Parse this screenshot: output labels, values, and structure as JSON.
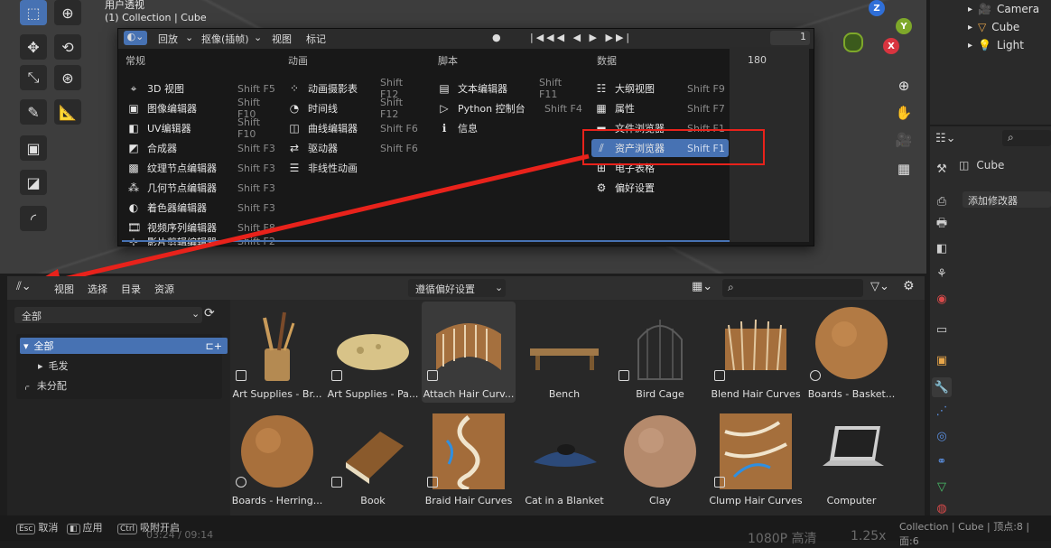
{
  "viewport": {
    "title": "用户透视",
    "subtitle": "(1) Collection | Cube"
  },
  "popup": {
    "header": {
      "menu1": "回放",
      "menu2": "抠像(插帧)",
      "menu3": "视图",
      "menu4": "标记",
      "frame": "1"
    },
    "timeline_frame": "180",
    "columns": [
      "常规",
      "动画",
      "脚本",
      "数据"
    ],
    "general": [
      {
        "label": "3D 视图",
        "shortcut": "Shift F5"
      },
      {
        "label": "图像编辑器",
        "shortcut": "Shift F10"
      },
      {
        "label": "UV编辑器",
        "shortcut": "Shift F10"
      },
      {
        "label": "合成器",
        "shortcut": "Shift F3"
      },
      {
        "label": "纹理节点编辑器",
        "shortcut": "Shift F3"
      },
      {
        "label": "几何节点编辑器",
        "shortcut": "Shift F3"
      },
      {
        "label": "着色器编辑器",
        "shortcut": "Shift F3"
      },
      {
        "label": "视频序列编辑器",
        "shortcut": "Shift F8"
      },
      {
        "label": "影片剪辑编辑器",
        "shortcut": "Shift F2"
      }
    ],
    "animation": [
      {
        "label": "动画摄影表",
        "shortcut": "Shift F12"
      },
      {
        "label": "时间线",
        "shortcut": "Shift F12"
      },
      {
        "label": "曲线编辑器",
        "shortcut": "Shift F6"
      },
      {
        "label": "驱动器",
        "shortcut": "Shift F6"
      },
      {
        "label": "非线性动画",
        "shortcut": ""
      }
    ],
    "scripting": [
      {
        "label": "文本编辑器",
        "shortcut": "Shift F11"
      },
      {
        "label": "Python 控制台",
        "shortcut": "Shift F4"
      },
      {
        "label": "信息",
        "shortcut": ""
      }
    ],
    "data": [
      {
        "label": "大纲视图",
        "shortcut": "Shift F9"
      },
      {
        "label": "属性",
        "shortcut": "Shift F7"
      },
      {
        "label": "文件浏览器",
        "shortcut": "Shift F1"
      },
      {
        "label": "资产浏览器",
        "shortcut": "Shift F1"
      },
      {
        "label": "电子表格",
        "shortcut": ""
      },
      {
        "label": "偏好设置",
        "shortcut": ""
      }
    ]
  },
  "asset_browser": {
    "menus": [
      "视图",
      "选择",
      "目录",
      "资源"
    ],
    "import_method": "遵循偏好设置",
    "library": "全部",
    "tree": {
      "root": "全部",
      "child": "毛发",
      "unassigned": "未分配"
    },
    "assets": [
      "Art Supplies - Br...",
      "Art Supplies - Pa...",
      "Attach Hair Curv...",
      "Bench",
      "Bird Cage",
      "Blend Hair Curves",
      "Boards - Basket...",
      "Boards - Herring...",
      "Book",
      "Braid Hair Curves",
      "Cat in a Blanket",
      "Clay",
      "Clump Hair Curves",
      "Computer"
    ]
  },
  "outliner": {
    "items": [
      "Camera",
      "Cube",
      "Light"
    ]
  },
  "properties": {
    "object": "Cube",
    "add_modifier": "添加修改器"
  },
  "statusbar": {
    "cancel": "取消",
    "apply": "应用",
    "snap": "吸附开启",
    "info": "Collection | Cube | 顶点:8 | 面:6",
    "video_time": "03:24 / 09:14",
    "quality": "1080P 高清",
    "speed": "1.25x"
  },
  "colors": {
    "accent": "#4772b3",
    "annotation": "#e8221b"
  }
}
